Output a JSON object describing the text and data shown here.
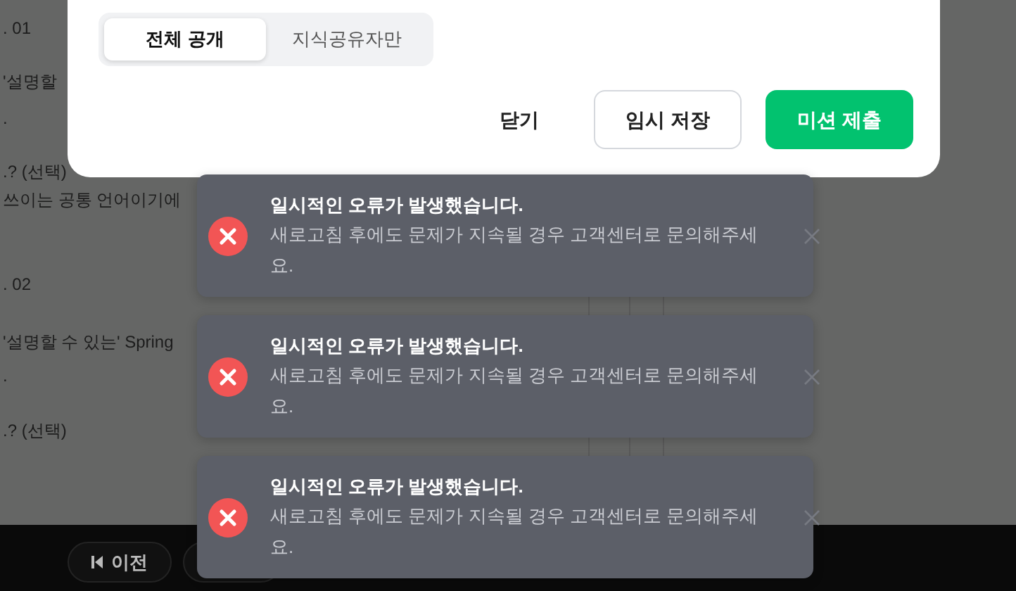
{
  "background_page": {
    "lines": [
      {
        "text": ". 01"
      },
      {
        "text": "'설명할"
      },
      {
        "text": "."
      },
      {
        "text": ".? (선택)"
      },
      {
        "text": "쓰이는 공통 언어이기에"
      },
      {
        "text": ". 02"
      },
      {
        "text": "'설명할 수 있는' Spring"
      },
      {
        "text": "."
      },
      {
        "text": ".? (선택)"
      }
    ]
  },
  "bottom_bar": {
    "buttons": [
      {
        "label": "이전",
        "kind": "prev"
      },
      {
        "kind": "hidden"
      }
    ]
  },
  "modal": {
    "visibility_tabs": [
      {
        "label": "전체 공개",
        "selected": true
      },
      {
        "label": "지식공유자만",
        "selected": false
      }
    ],
    "actions": [
      {
        "label": "닫기",
        "kind": "text"
      },
      {
        "label": "임시 저장",
        "kind": "outline"
      },
      {
        "label": "미션 제출",
        "kind": "primary"
      }
    ]
  },
  "toasts": [
    {
      "title": "일시적인 오류가 발생했습니다.",
      "message": "새로고침 후에도 문제가 지속될 경우 고객센터로 문의해주세요.",
      "kind": "error"
    },
    {
      "title": "일시적인 오류가 발생했습니다.",
      "message": "새로고침 후에도 문제가 지속될 경우 고객센터로 문의해주세요.",
      "kind": "error"
    },
    {
      "title": "일시적인 오류가 발생했습니다.",
      "message": "새로고침 후에도 문제가 지속될 경우 고객센터로 문의해주세요.",
      "kind": "error"
    }
  ]
}
